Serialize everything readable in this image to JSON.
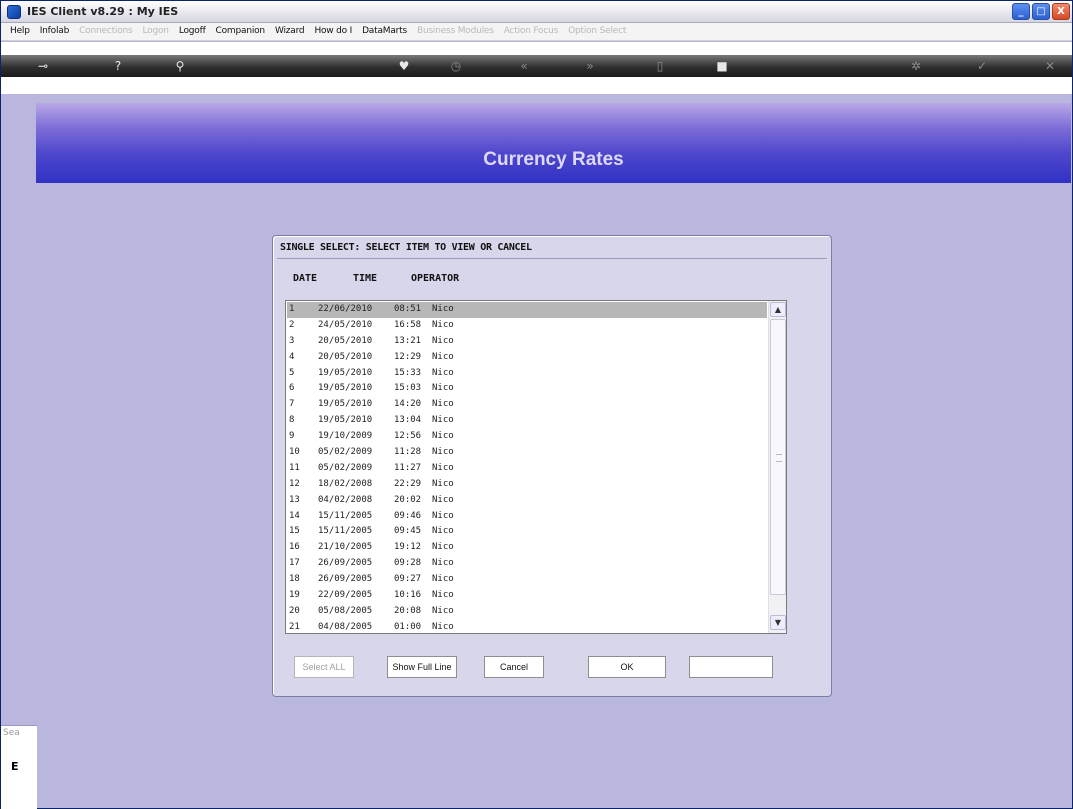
{
  "window": {
    "title": "IES Client v8.29 : My IES",
    "controls": {
      "minimize": "_",
      "maximize": "□",
      "close": "X"
    }
  },
  "menu": [
    {
      "label": "Help",
      "enabled": true
    },
    {
      "label": "Infolab",
      "enabled": true
    },
    {
      "label": "Connections",
      "enabled": false
    },
    {
      "label": "Logon",
      "enabled": false
    },
    {
      "label": "Logoff",
      "enabled": true
    },
    {
      "label": "Companion",
      "enabled": true
    },
    {
      "label": "Wizard",
      "enabled": true
    },
    {
      "label": "How do I",
      "enabled": true
    },
    {
      "label": "DataMarts",
      "enabled": true
    },
    {
      "label": "Business Modules",
      "enabled": false
    },
    {
      "label": "Action Focus",
      "enabled": false
    },
    {
      "label": "Option Select",
      "enabled": false
    }
  ],
  "toolbar_icons": {
    "key": "⊸",
    "help": "?",
    "search": "⚲",
    "heart": "♥",
    "clock": "◷",
    "prev": "«",
    "next": "»",
    "copy": "▯",
    "stop": "■",
    "settings": "✲",
    "ok": "✓",
    "close": "✕"
  },
  "banner": {
    "title": "Currency Rates"
  },
  "left_panel": {
    "label_top": "Sea",
    "label_bottom": "E"
  },
  "dialog": {
    "header": "SINGLE SELECT: SELECT ITEM TO VIEW OR CANCEL",
    "columns": {
      "date": "DATE",
      "time": "TIME",
      "operator": "OPERATOR"
    },
    "rows": [
      {
        "num": "1",
        "date": "22/06/2010",
        "time": "08:51",
        "operator": "Nico"
      },
      {
        "num": "2",
        "date": "24/05/2010",
        "time": "16:58",
        "operator": "Nico"
      },
      {
        "num": "3",
        "date": "20/05/2010",
        "time": "13:21",
        "operator": "Nico"
      },
      {
        "num": "4",
        "date": "20/05/2010",
        "time": "12:29",
        "operator": "Nico"
      },
      {
        "num": "5",
        "date": "19/05/2010",
        "time": "15:33",
        "operator": "Nico"
      },
      {
        "num": "6",
        "date": "19/05/2010",
        "time": "15:03",
        "operator": "Nico"
      },
      {
        "num": "7",
        "date": "19/05/2010",
        "time": "14:20",
        "operator": "Nico"
      },
      {
        "num": "8",
        "date": "19/05/2010",
        "time": "13:04",
        "operator": "Nico"
      },
      {
        "num": "9",
        "date": "19/10/2009",
        "time": "12:56",
        "operator": "Nico"
      },
      {
        "num": "10",
        "date": "05/02/2009",
        "time": "11:28",
        "operator": "Nico"
      },
      {
        "num": "11",
        "date": "05/02/2009",
        "time": "11:27",
        "operator": "Nico"
      },
      {
        "num": "12",
        "date": "18/02/2008",
        "time": "22:29",
        "operator": "Nico"
      },
      {
        "num": "13",
        "date": "04/02/2008",
        "time": "20:02",
        "operator": "Nico"
      },
      {
        "num": "14",
        "date": "15/11/2005",
        "time": "09:46",
        "operator": "Nico"
      },
      {
        "num": "15",
        "date": "15/11/2005",
        "time": "09:45",
        "operator": "Nico"
      },
      {
        "num": "16",
        "date": "21/10/2005",
        "time": "19:12",
        "operator": "Nico"
      },
      {
        "num": "17",
        "date": "26/09/2005",
        "time": "09:28",
        "operator": "Nico"
      },
      {
        "num": "18",
        "date": "26/09/2005",
        "time": "09:27",
        "operator": "Nico"
      },
      {
        "num": "19",
        "date": "22/09/2005",
        "time": "10:16",
        "operator": "Nico"
      },
      {
        "num": "20",
        "date": "05/08/2005",
        "time": "20:08",
        "operator": "Nico"
      },
      {
        "num": "21",
        "date": "04/08/2005",
        "time": "01:00",
        "operator": "Nico"
      }
    ],
    "selected_index": 0,
    "scroll_up": "▲",
    "scroll_down": "▼",
    "buttons": {
      "select_all": "Select ALL",
      "show_full_line": "Show Full Line",
      "cancel": "Cancel",
      "ok": "OK"
    },
    "input_value": ""
  }
}
